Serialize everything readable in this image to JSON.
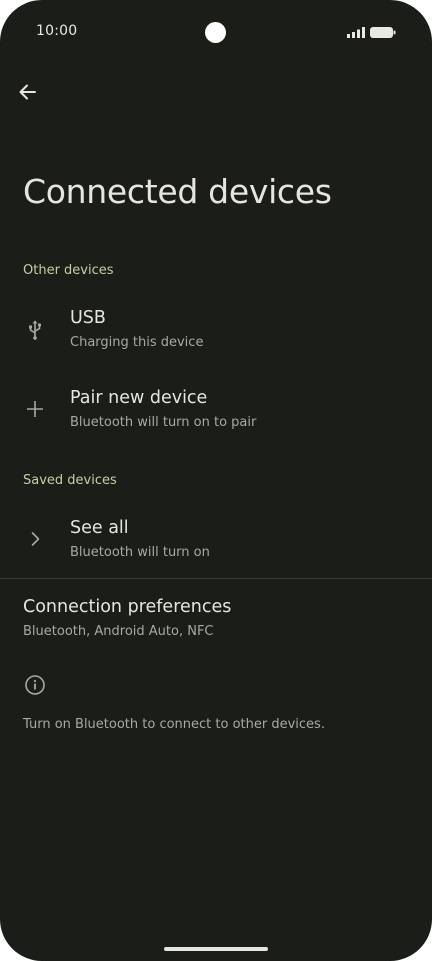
{
  "status_bar": {
    "time": "10:00"
  },
  "header": {
    "back_icon": "arrow-back-icon",
    "title": "Connected devices"
  },
  "other_devices": {
    "heading": "Other devices",
    "items": [
      {
        "icon": "usb-icon",
        "title": "USB",
        "subtitle": "Charging this device"
      },
      {
        "icon": "plus-icon",
        "title": "Pair new device",
        "subtitle": "Bluetooth will turn on to pair"
      }
    ]
  },
  "saved_devices": {
    "heading": "Saved devices",
    "see_all": {
      "icon": "chevron-right-icon",
      "title": "See all",
      "subtitle": "Bluetooth will turn on"
    }
  },
  "connection_preferences": {
    "title": "Connection preferences",
    "subtitle": "Bluetooth, Android Auto, NFC"
  },
  "info": {
    "icon": "info-icon",
    "text": "Turn on Bluetooth to connect to other devices."
  },
  "colors": {
    "background": "#1b1e18",
    "accent": "#c4cfa3",
    "text": "#e6e6de",
    "secondary_text": "#a7aa9f"
  }
}
